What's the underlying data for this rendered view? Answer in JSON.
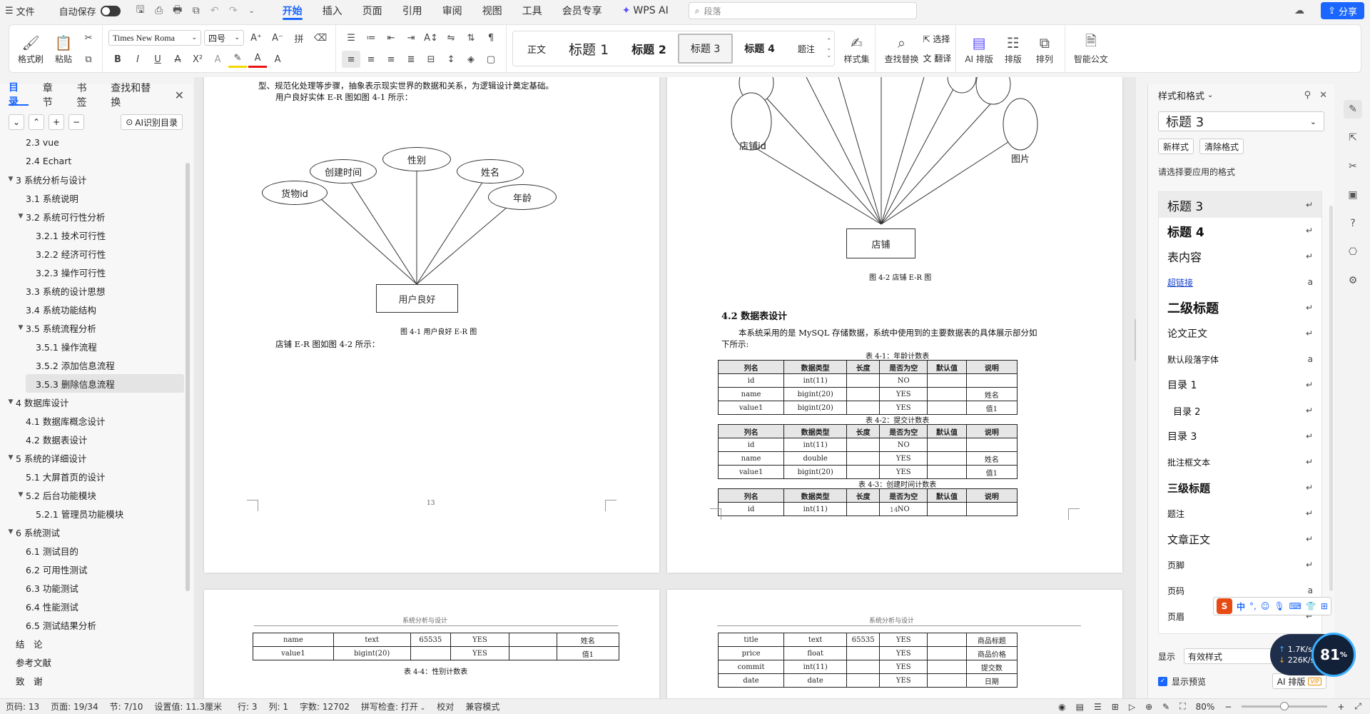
{
  "titlebar": {
    "file_menu": "文件",
    "autosave_label": "自动保存",
    "tabs": [
      "开始",
      "插入",
      "页面",
      "引用",
      "审阅",
      "视图",
      "工具",
      "会员专享"
    ],
    "active_tab": "开始",
    "wps_ai": "WPS AI",
    "search_placeholder": "段落",
    "share": "分享"
  },
  "ribbon": {
    "format_painter": "格式刷",
    "paste": "粘贴",
    "font_name": "Times New Roma",
    "font_size": "四号",
    "styles": [
      "正文",
      "标题 1",
      "标题 2",
      "标题 3",
      "标题 4",
      "题注"
    ],
    "style_set": "样式集",
    "find_replace": "查找替换",
    "select": "选择",
    "translate": "翻译",
    "ai_layout": "AI 排版",
    "layout": "排版",
    "arrange": "排列",
    "smart_doc": "智能公文"
  },
  "left_panel": {
    "tabs": [
      "目录",
      "章节",
      "书签",
      "查找和替换"
    ],
    "ai_toc": "AI识别目录",
    "toc": [
      {
        "label": "2.3 vue",
        "level": 2,
        "arrow": ""
      },
      {
        "label": "2.4 Echart",
        "level": 2,
        "arrow": ""
      },
      {
        "label": "3 系统分析与设计",
        "level": 1,
        "arrow": "▼"
      },
      {
        "label": "3.1 系统说明",
        "level": 2,
        "arrow": ""
      },
      {
        "label": "3.2 系统可行性分析",
        "level": 2,
        "arrow": "▼"
      },
      {
        "label": "3.2.1 技术可行性",
        "level": 3,
        "arrow": ""
      },
      {
        "label": "3.2.2 经济可行性",
        "level": 3,
        "arrow": ""
      },
      {
        "label": "3.2.3 操作可行性",
        "level": 3,
        "arrow": ""
      },
      {
        "label": "3.3 系统的设计思想",
        "level": 2,
        "arrow": ""
      },
      {
        "label": "3.4 系统功能结构",
        "level": 2,
        "arrow": ""
      },
      {
        "label": "3.5 系统流程分析",
        "level": 2,
        "arrow": "▼"
      },
      {
        "label": "3.5.1 操作流程",
        "level": 3,
        "arrow": ""
      },
      {
        "label": "3.5.2 添加信息流程",
        "level": 3,
        "arrow": ""
      },
      {
        "label": "3.5.3 删除信息流程",
        "level": 3,
        "arrow": "",
        "current": true
      },
      {
        "label": "4 数据库设计",
        "level": 1,
        "arrow": "▼"
      },
      {
        "label": "4.1 数据库概念设计",
        "level": 2,
        "arrow": ""
      },
      {
        "label": "4.2 数据表设计",
        "level": 2,
        "arrow": ""
      },
      {
        "label": "5 系统的详细设计",
        "level": 1,
        "arrow": "▼"
      },
      {
        "label": "5.1 大屏首页的设计",
        "level": 2,
        "arrow": ""
      },
      {
        "label": "5.2 后台功能模块",
        "level": 2,
        "arrow": "▼"
      },
      {
        "label": "5.2.1 管理员功能模块",
        "level": 3,
        "arrow": ""
      },
      {
        "label": "6 系统测试",
        "level": 1,
        "arrow": "▼"
      },
      {
        "label": "6.1 测试目的",
        "level": 2,
        "arrow": ""
      },
      {
        "label": "6.2 可用性测试",
        "level": 2,
        "arrow": ""
      },
      {
        "label": "6.3 功能测试",
        "level": 2,
        "arrow": ""
      },
      {
        "label": "6.4 性能测试",
        "level": 2,
        "arrow": ""
      },
      {
        "label": "6.5 测试结果分析",
        "level": 2,
        "arrow": ""
      },
      {
        "label": "结　论",
        "level": 1,
        "arrow": ""
      },
      {
        "label": "参考文献",
        "level": 1,
        "arrow": ""
      },
      {
        "label": "致　谢",
        "level": 1,
        "arrow": ""
      }
    ]
  },
  "page13": {
    "line1": "型、规范化处理等步骤，抽象表示现实世界的数据和关系，为逻辑设计奠定基础。",
    "line2": "用户良好实体 E-R 图如图 4-1 所示：",
    "er_entity": "用户良好",
    "er_attrs": [
      "货物id",
      "创建时间",
      "性别",
      "姓名",
      "年龄"
    ],
    "fig_caption": "图 4-1 用户良好 E-R 图",
    "line3": "店铺 E-R 图如图 4-2 所示：",
    "page_number": "13"
  },
  "page14": {
    "er_entity": "店铺",
    "er_attrs_visible": [
      "店铺id",
      "图片"
    ],
    "fig_caption": "图 4-2 店铺 E-R 图",
    "section_heading": "4.2 数据表设计",
    "para1": "本系统采用的是 MySQL 存储数据，系统中使用到的主要数据表的具体展示部分如",
    "para2": "下所示:",
    "table_headers": [
      "列名",
      "数据类型",
      "长度",
      "是否为空",
      "默认值",
      "说明"
    ],
    "table1_caption": "表 4-1：年龄计数表",
    "table1_rows": [
      [
        "id",
        "int(11)",
        "",
        "NO",
        "",
        ""
      ],
      [
        "name",
        "bigint(20)",
        "",
        "YES",
        "",
        "姓名"
      ],
      [
        "value1",
        "bigint(20)",
        "",
        "YES",
        "",
        "值1"
      ]
    ],
    "table2_caption": "表 4-2：提交计数表",
    "table2_rows": [
      [
        "id",
        "int(11)",
        "",
        "NO",
        "",
        ""
      ],
      [
        "name",
        "double",
        "",
        "YES",
        "",
        "姓名"
      ],
      [
        "value1",
        "bigint(20)",
        "",
        "YES",
        "",
        "值1"
      ]
    ],
    "table3_caption": "表 4-3：创建时间计数表",
    "table3_rows": [
      [
        "id",
        "int(11)",
        "",
        "NO",
        "",
        ""
      ]
    ],
    "page_number": "14"
  },
  "page15": {
    "header": "系统分析与设计",
    "rows": [
      [
        "name",
        "text",
        "65535",
        "YES",
        "",
        "姓名"
      ],
      [
        "value1",
        "bigint(20)",
        "",
        "YES",
        "",
        "值1"
      ]
    ],
    "caption": "表 4-4：性别计数表"
  },
  "page16": {
    "header": "系统分析与设计",
    "rows": [
      [
        "title",
        "text",
        "65535",
        "YES",
        "",
        "商品标题"
      ],
      [
        "price",
        "float",
        "",
        "YES",
        "",
        "商品价格"
      ],
      [
        "commit",
        "int(11)",
        "",
        "YES",
        "",
        "提交数"
      ],
      [
        "date",
        "date",
        "",
        "YES",
        "",
        "日期"
      ]
    ]
  },
  "right_panel": {
    "title": "样式和格式",
    "current_style": "标题 3",
    "new_style": "新样式",
    "clear_format": "清除格式",
    "prompt": "请选择要应用的格式",
    "styles": [
      {
        "name": "标题 3",
        "cur": true,
        "fs": 17,
        "bold": false,
        "ret": "↵"
      },
      {
        "name": "标题 4",
        "cur": false,
        "fs": 17,
        "bold": true,
        "ret": "↵"
      },
      {
        "name": "表内容",
        "cur": false,
        "fs": 16,
        "bold": false,
        "ret": "↵"
      },
      {
        "name": "超链接",
        "cur": false,
        "fs": 12,
        "bold": false,
        "ret": "a",
        "link": true
      },
      {
        "name": "二级标题",
        "cur": false,
        "fs": 18,
        "bold": true,
        "ret": "↵"
      },
      {
        "name": "论文正文",
        "cur": false,
        "fs": 14,
        "bold": false,
        "ret": "↵"
      },
      {
        "name": "默认段落字体",
        "cur": false,
        "fs": 12,
        "bold": false,
        "ret": "a"
      },
      {
        "name": "目录 1",
        "cur": false,
        "fs": 14,
        "bold": false,
        "ret": "↵"
      },
      {
        "name": "目录 2",
        "cur": false,
        "fs": 13,
        "bold": false,
        "ret": "↵",
        "indent": true
      },
      {
        "name": "目录 3",
        "cur": false,
        "fs": 14,
        "bold": false,
        "ret": "↵"
      },
      {
        "name": "批注框文本",
        "cur": false,
        "fs": 12,
        "bold": false,
        "ret": "↵"
      },
      {
        "name": "三级标题",
        "cur": false,
        "fs": 15,
        "bold": true,
        "ret": "↵"
      },
      {
        "name": "题注",
        "cur": false,
        "fs": 12,
        "bold": false,
        "ret": "↵"
      },
      {
        "name": "文章正文",
        "cur": false,
        "fs": 15,
        "bold": false,
        "ret": "↵"
      },
      {
        "name": "页脚",
        "cur": false,
        "fs": 12,
        "bold": false,
        "ret": "↵"
      },
      {
        "name": "页码",
        "cur": false,
        "fs": 12,
        "bold": false,
        "ret": "a"
      },
      {
        "name": "页眉",
        "cur": false,
        "fs": 12,
        "bold": false,
        "ret": "↵"
      }
    ],
    "show_label": "显示",
    "show_value": "有效样式",
    "preview_label": "显示预览",
    "ai_layout": "AI 排版"
  },
  "ime": {
    "lang": "中"
  },
  "net": {
    "up": "1.7K/s",
    "down": "226K/s",
    "percent": "81"
  },
  "statusbar": {
    "page_code": "页码: 13",
    "page": "页面: 19/34",
    "section": "节: 7/10",
    "setting": "设置值: 11.3厘米",
    "row": "行: 3",
    "col": "列: 1",
    "words": "字数: 12702",
    "spell": "拼写检查: 打开",
    "proof": "校对",
    "compat": "兼容模式",
    "zoom": "80%"
  }
}
